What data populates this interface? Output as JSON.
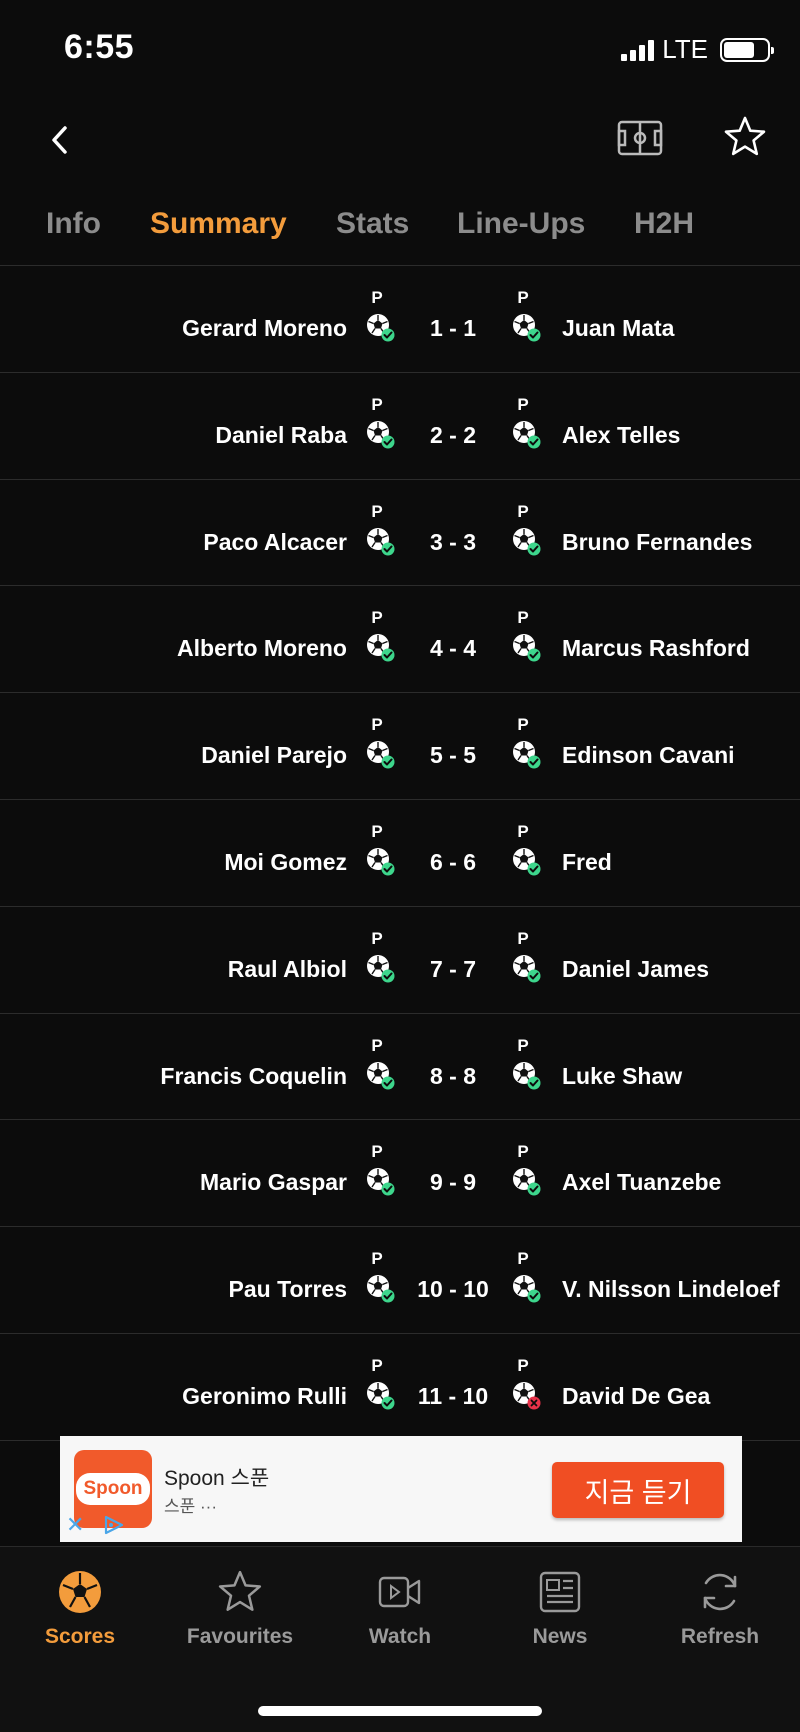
{
  "status": {
    "time": "6:55",
    "network": "LTE",
    "battery_percent": 72
  },
  "header": {
    "back_icon": "chevron-left-icon",
    "pitch_icon": "football-pitch-icon",
    "star_icon": "star-outline-icon"
  },
  "tabs": [
    {
      "label": "Info",
      "active": false
    },
    {
      "label": "Summary",
      "active": true
    },
    {
      "label": "Stats",
      "active": false
    },
    {
      "label": "Line-Ups",
      "active": false
    },
    {
      "label": "H2H",
      "active": false
    }
  ],
  "penalty_marker": "P",
  "rows": [
    {
      "home": "Gerard Moreno",
      "score": "1 - 1",
      "away": "Juan Mata",
      "home_result": "scored",
      "away_result": "scored"
    },
    {
      "home": "Daniel Raba",
      "score": "2 - 2",
      "away": "Alex Telles",
      "home_result": "scored",
      "away_result": "scored"
    },
    {
      "home": "Paco Alcacer",
      "score": "3 - 3",
      "away": "Bruno Fernandes",
      "home_result": "scored",
      "away_result": "scored"
    },
    {
      "home": "Alberto Moreno",
      "score": "4 - 4",
      "away": "Marcus Rashford",
      "home_result": "scored",
      "away_result": "scored"
    },
    {
      "home": "Daniel Parejo",
      "score": "5 - 5",
      "away": "Edinson Cavani",
      "home_result": "scored",
      "away_result": "scored"
    },
    {
      "home": "Moi Gomez",
      "score": "6 - 6",
      "away": "Fred",
      "home_result": "scored",
      "away_result": "scored"
    },
    {
      "home": "Raul Albiol",
      "score": "7 - 7",
      "away": "Daniel James",
      "home_result": "scored",
      "away_result": "scored"
    },
    {
      "home": "Francis Coquelin",
      "score": "8 - 8",
      "away": "Luke Shaw",
      "home_result": "scored",
      "away_result": "scored"
    },
    {
      "home": "Mario Gaspar",
      "score": "9 - 9",
      "away": "Axel Tuanzebe",
      "home_result": "scored",
      "away_result": "scored"
    },
    {
      "home": "Pau Torres",
      "score": "10 - 10",
      "away": "V. Nilsson Lindeloef",
      "home_result": "scored",
      "away_result": "scored"
    },
    {
      "home": "Geronimo Rulli",
      "score": "11 - 10",
      "away": "David De Gea",
      "home_result": "scored",
      "away_result": "missed"
    }
  ],
  "ad": {
    "logo_text": "Spoon",
    "title": "Spoon 스푼",
    "subtitle": "스푼 ···",
    "cta": "지금 듣기",
    "close_icon": "close-icon",
    "adchoices_icon": "adchoices-icon"
  },
  "bottom_nav": [
    {
      "label": "Scores",
      "icon": "soccer-ball-icon",
      "active": true
    },
    {
      "label": "Favourites",
      "icon": "star-outline-icon",
      "active": false
    },
    {
      "label": "Watch",
      "icon": "video-icon",
      "active": false
    },
    {
      "label": "News",
      "icon": "newspaper-icon",
      "active": false
    },
    {
      "label": "Refresh",
      "icon": "refresh-icon",
      "active": false
    }
  ],
  "colors": {
    "background": "#0c0c0c",
    "accent": "#f39c3c",
    "inactive": "#8c8c8c",
    "scored": "#3dd68c",
    "missed": "#e8324a",
    "ad_cta": "#f04e23"
  }
}
